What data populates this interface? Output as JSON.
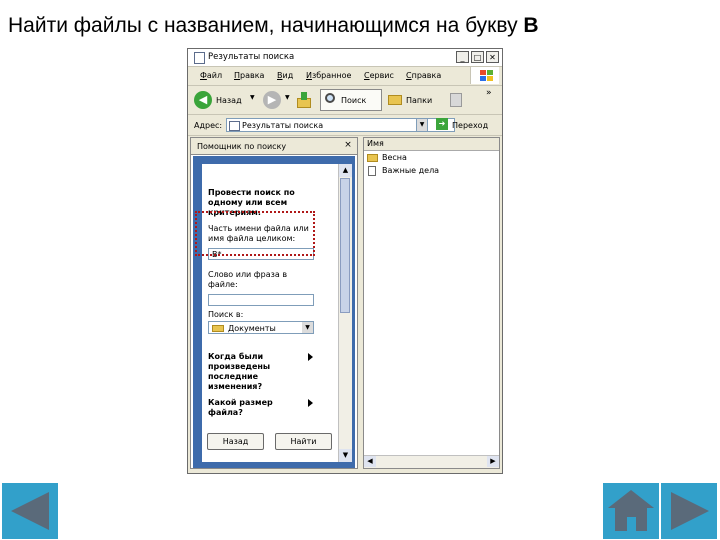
{
  "slide": {
    "title_prefix": "Найти файлы с названием, начинающимся на букву ",
    "title_letter": "В"
  },
  "window": {
    "title": "Результаты поиска",
    "controls": {
      "minimize": "_",
      "maximize": "□",
      "close": "✕"
    },
    "menu": [
      "Файл",
      "Правка",
      "Вид",
      "Избранное",
      "Сервис",
      "Справка"
    ],
    "toolbar": {
      "back_label": "Назад",
      "search_label": "Поиск",
      "folders_label": "Папки",
      "more": "»"
    },
    "address": {
      "label": "Адрес:",
      "value": "Результаты поиска",
      "go_label": "Переход"
    }
  },
  "search_panel": {
    "header": "Помощник по поиску",
    "close": "×",
    "intro": [
      "Провести поиск по",
      "одному или всем",
      "критериям."
    ],
    "filename_label": [
      "Часть имени файла или",
      "имя файла целиком:"
    ],
    "filename_value": "В*",
    "phrase_label": [
      "Слово или фраза в",
      "файле:"
    ],
    "phrase_value": "",
    "lookin_label": "Поиск в:",
    "lookin_value": "Документы",
    "modified_label": [
      "Когда были",
      "произведены",
      "последние",
      "изменения?"
    ],
    "size_label": [
      "Какой размер",
      "файла?"
    ],
    "back_button": "Назад",
    "find_button": "Найти"
  },
  "results": {
    "column_name": "Имя",
    "items": [
      {
        "name": "Весна",
        "icon": "folder-icon"
      },
      {
        "name": "Важные дела",
        "icon": "document-icon"
      }
    ]
  },
  "colors": {
    "panel_blue": "#3e6bab",
    "nav_accent": "#32a0ca",
    "highlight_red": "#b01818"
  },
  "nav": {
    "prev_icon": "triangle-left-icon",
    "home_icon": "home-icon",
    "next_icon": "triangle-right-icon"
  }
}
